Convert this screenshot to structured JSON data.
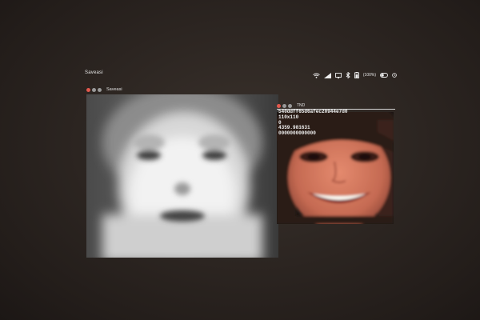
{
  "menubar": {
    "app_name": "Saveasi",
    "battery_text": "(100%)",
    "icons": [
      "wifi-icon",
      "signal-icon",
      "display-icon",
      "bluetooth-icon",
      "battery-icon",
      "toggle-icon",
      "clock-icon"
    ]
  },
  "left_window": {
    "title": "Saveasi",
    "content": "averaged-face-image"
  },
  "right_window": {
    "title": "TND",
    "info_lines": [
      "540ddff65d6afec20944e7d0",
      "110x110",
      "0",
      "4359.981631",
      "0000000000000"
    ],
    "content": "face-photo"
  },
  "colors": {
    "wall": "#2a231f",
    "text": "#eeeeee",
    "close_button": "#e2584d"
  }
}
